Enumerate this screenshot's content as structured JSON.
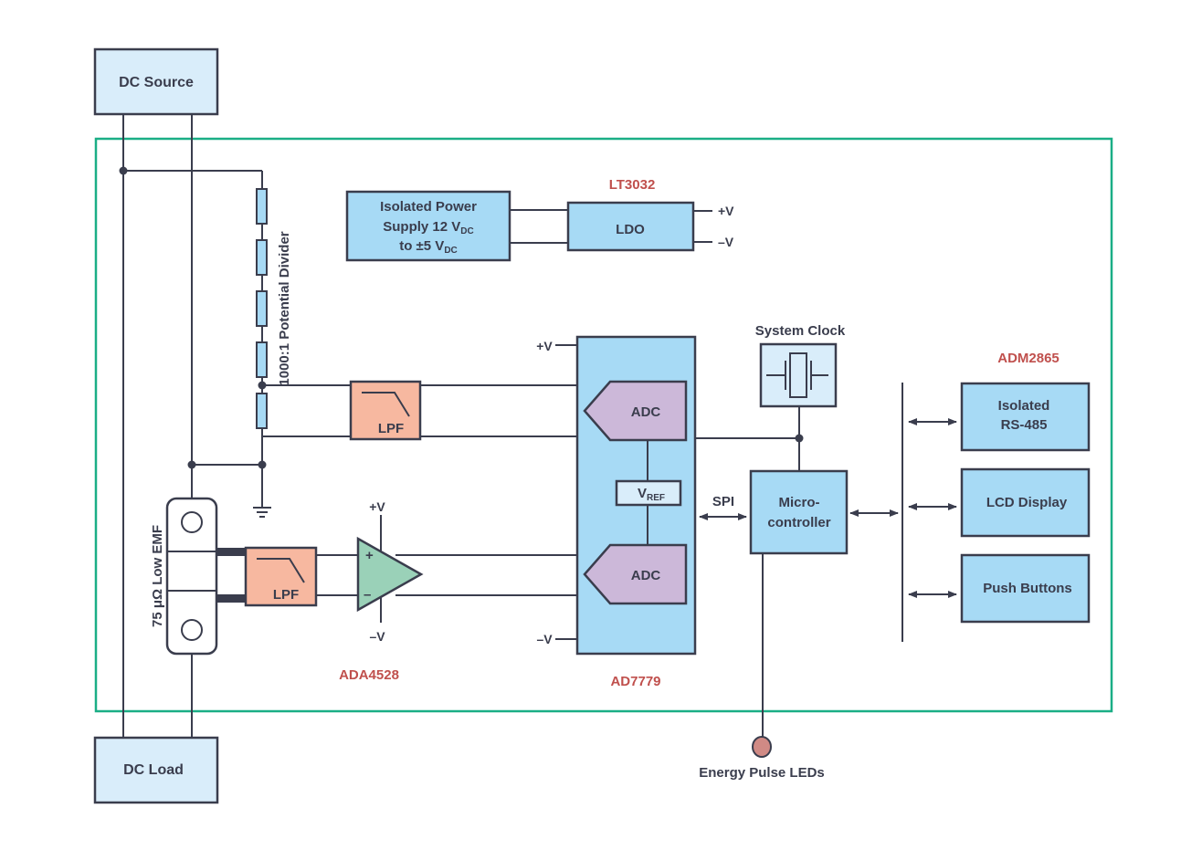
{
  "colors": {
    "line": "#3a3d4d",
    "boundary": "#1aae86",
    "light_blue": "#d9edfa",
    "mid_blue": "#a7daf5",
    "lpf_fill": "#f7b8a0",
    "adc_fill": "#ccb8d9",
    "amp_fill": "#9ad1b8",
    "led_fill": "#d08a85",
    "part_label": "#c0504d"
  },
  "blocks": {
    "dc_source": "DC Source",
    "dc_load": "DC Load",
    "power_supply": {
      "line1": "Isolated Power",
      "line2_main": "Supply 12 V",
      "line2_sub": "DC",
      "line3_main": "to ±5 V",
      "line3_sub": "DC"
    },
    "ldo": "LDO",
    "ldo_part": "LT3032",
    "ldo_pos": "+V",
    "ldo_neg": "–V",
    "divider_label": "1000:1 Potential Divider",
    "shunt_label": "75 μΩ Low EMF",
    "lpf_top": "LPF",
    "lpf_bottom": "LPF",
    "amp_pos_supply": "+V",
    "amp_neg_supply": "–V",
    "amp_plus": "+",
    "amp_minus": "–",
    "amp_part": "ADA4528",
    "adc_chip_pos": "+V",
    "adc_chip_neg": "–V",
    "adc_top": "ADC",
    "adc_bottom": "ADC",
    "vref_main": "V",
    "vref_sub": "REF",
    "adc_part": "AD7779",
    "spi": "SPI",
    "system_clock": "System Clock",
    "mcu_line1": "Micro-",
    "mcu_line2": "controller",
    "rs485_part": "ADM2865",
    "rs485_line1": "Isolated",
    "rs485_line2": "RS-485",
    "lcd": "LCD Display",
    "push_buttons": "Push Buttons",
    "leds": "Energy Pulse LEDs"
  }
}
